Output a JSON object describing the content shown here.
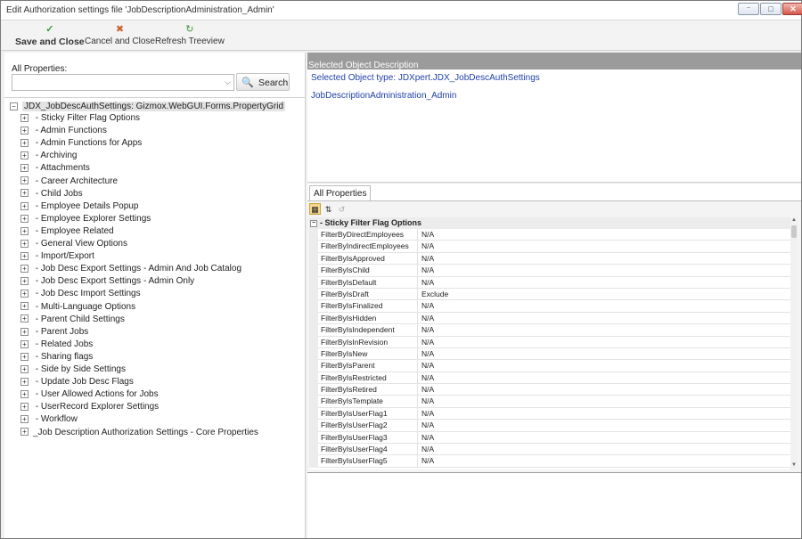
{
  "window": {
    "title": "Edit Authorization settings file 'JobDescriptionAdministration_Admin'",
    "controls": {
      "minimize": "⁻",
      "maximize": "□",
      "close": "✕"
    }
  },
  "toolbar": {
    "save_close": "Save and Close",
    "cancel_close": "Cancel and Close",
    "refresh": "Refresh Treeview",
    "save_icon": "✓",
    "cancel_icon": "✖",
    "refresh_icon": "↻"
  },
  "left": {
    "all_properties_label": "All Properties:",
    "combo_value": "",
    "search_label": "Search",
    "tree": {
      "root_label": "JDX_JobDescAuthSettings: Gizmox.WebGUI.Forms.PropertyGrid",
      "items": [
        " - Sticky Filter Flag Options",
        " - Admin Functions",
        " - Admin Functions for Apps",
        " - Archiving",
        " - Attachments",
        " - Career Architecture",
        " - Child Jobs",
        " - Employee Details Popup",
        " - Employee Explorer Settings",
        " - Employee Related",
        " - General View Options",
        " - Import/Export",
        " - Job Desc Export Settings - Admin And Job Catalog",
        " - Job Desc Export Settings - Admin Only",
        " - Job Desc Import Settings",
        " - Multi-Language Options",
        " - Parent Child Settings",
        " - Parent Jobs",
        " - Related Jobs",
        " - Sharing flags",
        " - Side by Side Settings",
        " - Update Job Desc Flags",
        " - User Allowed Actions for Jobs",
        " - UserRecord Explorer Settings",
        " - Workflow",
        "_Job Description Authorization Settings - Core Properties"
      ]
    }
  },
  "right": {
    "desc_header": "Selected Object Description",
    "object_type": "Selected Object type: JDXpert.JDX_JobDescAuthSettings",
    "object_name": "JobDescriptionAdministration_Admin",
    "tab_label": "All Properties",
    "category": "- Sticky Filter Flag Options",
    "properties": [
      {
        "name": "FilterByDirectEmployees",
        "value": "N/A"
      },
      {
        "name": "FilterByIndirectEmployees",
        "value": "N/A"
      },
      {
        "name": "FilterByIsApproved",
        "value": "N/A"
      },
      {
        "name": "FilterByIsChild",
        "value": "N/A"
      },
      {
        "name": "FilterByIsDefault",
        "value": "N/A"
      },
      {
        "name": "FilterByIsDraft",
        "value": "Exclude"
      },
      {
        "name": "FilterByIsFinalized",
        "value": "N/A"
      },
      {
        "name": "FilterByIsHidden",
        "value": "N/A"
      },
      {
        "name": "FilterByIsIndependent",
        "value": "N/A"
      },
      {
        "name": "FilterByIsInRevision",
        "value": "N/A"
      },
      {
        "name": "FilterByIsNew",
        "value": "N/A"
      },
      {
        "name": "FilterByIsParent",
        "value": "N/A"
      },
      {
        "name": "FilterByIsRestricted",
        "value": "N/A"
      },
      {
        "name": "FilterByIsRetired",
        "value": "N/A"
      },
      {
        "name": "FilterByIsTemplate",
        "value": "N/A"
      },
      {
        "name": "FilterByIsUserFlag1",
        "value": "N/A"
      },
      {
        "name": "FilterByIsUserFlag2",
        "value": "N/A"
      },
      {
        "name": "FilterByIsUserFlag3",
        "value": "N/A"
      },
      {
        "name": "FilterByIsUserFlag4",
        "value": "N/A"
      },
      {
        "name": "FilterByIsUserFlag5",
        "value": "N/A"
      }
    ]
  }
}
